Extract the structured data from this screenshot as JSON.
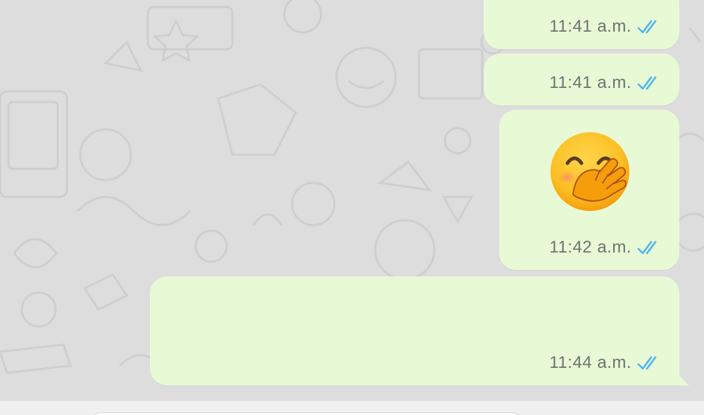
{
  "chat": {
    "messages": [
      {
        "time": "11:41 a.m.",
        "status_icon": "double-check-read-icon"
      },
      {
        "time": "11:41 a.m.",
        "status_icon": "double-check-read-icon"
      },
      {
        "time": "11:42 a.m.",
        "emoji": "face-with-hand-over-mouth",
        "status_icon": "double-check-read-icon"
      },
      {
        "time": "11:44 a.m.",
        "status_icon": "double-check-read-icon"
      }
    ]
  },
  "colors": {
    "wallpaper": "#ddddde",
    "outgoing_bubble": "#e8f9d6",
    "read_ticks": "#4fb3ee",
    "timestamp": "#6f726f"
  }
}
